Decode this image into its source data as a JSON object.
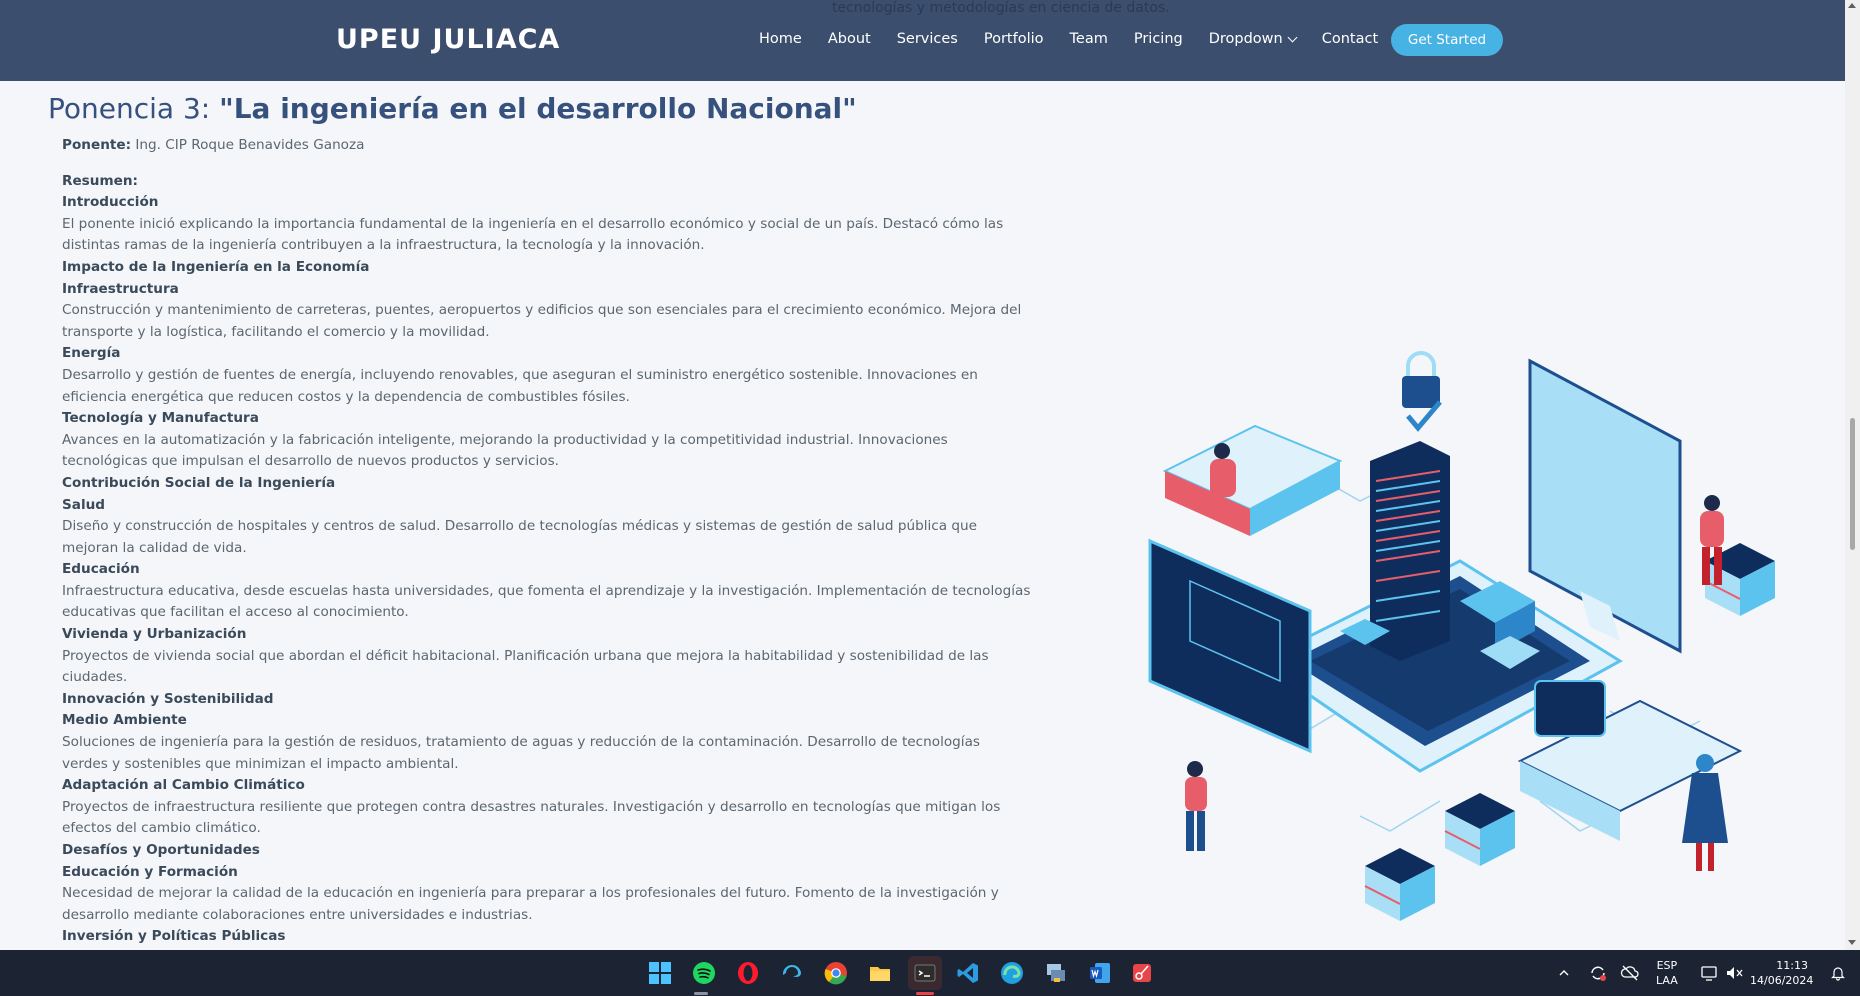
{
  "header": {
    "bleed_text": "tecnologías y metodologías en ciencia de datos.",
    "logo": "UPEU JULIACA",
    "nav": [
      "Home",
      "About",
      "Services",
      "Portfolio",
      "Team",
      "Pricing",
      "Dropdown",
      "Contact"
    ],
    "cta": "Get Started"
  },
  "main": {
    "heading_prefix": "Ponencia 3: ",
    "heading_title": "\"La ingeniería en el desarrollo Nacional\"",
    "speaker_label": "Ponente:",
    "speaker_name": " Ing. CIP Roque Benavides Ganoza",
    "summary_label": "Resumen:",
    "lines": [
      {
        "t": "Introducción",
        "b": true
      },
      {
        "t": "El ponente inició explicando la importancia fundamental de la ingeniería en el desarrollo económico y social de un país. Destacó cómo las",
        "b": false
      },
      {
        "t": "distintas ramas de la ingeniería contribuyen a la infraestructura, la tecnología y la innovación.",
        "b": false
      },
      {
        "t": "Impacto de la Ingeniería en la Economía",
        "b": true
      },
      {
        "t": "Infraestructura",
        "b": true
      },
      {
        "t": "Construcción y mantenimiento de carreteras, puentes, aeropuertos y edificios que son esenciales para el crecimiento económico. Mejora del",
        "b": false
      },
      {
        "t": "transporte y la logística, facilitando el comercio y la movilidad.",
        "b": false
      },
      {
        "t": "Energía",
        "b": true
      },
      {
        "t": "Desarrollo y gestión de fuentes de energía, incluyendo renovables, que aseguran el suministro energético sostenible. Innovaciones en",
        "b": false
      },
      {
        "t": "eficiencia energética que reducen costos y la dependencia de combustibles fósiles.",
        "b": false
      },
      {
        "t": "Tecnología y Manufactura",
        "b": true
      },
      {
        "t": "Avances en la automatización y la fabricación inteligente, mejorando la productividad y la competitividad industrial. Innovaciones",
        "b": false
      },
      {
        "t": "tecnológicas que impulsan el desarrollo de nuevos productos y servicios.",
        "b": false
      },
      {
        "t": "Contribución Social de la Ingeniería",
        "b": true
      },
      {
        "t": "Salud",
        "b": true
      },
      {
        "t": "Diseño y construcción de hospitales y centros de salud. Desarrollo de tecnologías médicas y sistemas de gestión de salud pública que",
        "b": false
      },
      {
        "t": "mejoran la calidad de vida.",
        "b": false
      },
      {
        "t": "Educación",
        "b": true
      },
      {
        "t": "Infraestructura educativa, desde escuelas hasta universidades, que fomenta el aprendizaje y la investigación. Implementación de tecnologías",
        "b": false
      },
      {
        "t": "educativas que facilitan el acceso al conocimiento.",
        "b": false
      },
      {
        "t": "Vivienda y Urbanización",
        "b": true
      },
      {
        "t": "Proyectos de vivienda social que abordan el déficit habitacional. Planificación urbana que mejora la habitabilidad y sostenibilidad de las",
        "b": false
      },
      {
        "t": "ciudades.",
        "b": false
      },
      {
        "t": "Innovación y Sostenibilidad",
        "b": true
      },
      {
        "t": "Medio Ambiente",
        "b": true
      },
      {
        "t": "Soluciones de ingeniería para la gestión de residuos, tratamiento de aguas y reducción de la contaminación. Desarrollo de tecnologías",
        "b": false
      },
      {
        "t": "verdes y sostenibles que minimizan el impacto ambiental.",
        "b": false
      },
      {
        "t": "Adaptación al Cambio Climático",
        "b": true
      },
      {
        "t": "Proyectos de infraestructura resiliente que protegen contra desastres naturales. Investigación y desarrollo en tecnologías que mitigan los",
        "b": false
      },
      {
        "t": "efectos del cambio climático.",
        "b": false
      },
      {
        "t": "Desafíos y Oportunidades",
        "b": true
      },
      {
        "t": "Educación y Formación",
        "b": true
      },
      {
        "t": "Necesidad de mejorar la calidad de la educación en ingeniería para preparar a los profesionales del futuro. Fomento de la investigación y",
        "b": false
      },
      {
        "t": "desarrollo mediante colaboraciones entre universidades e industrias.",
        "b": false
      },
      {
        "t": "Inversión y Políticas Públicas",
        "b": true
      }
    ]
  },
  "taskbar": {
    "lang": "ESP",
    "layout": "LAA",
    "time": "11:13",
    "date": "14/06/2024"
  },
  "colors": {
    "header_bg": "#3b4e6d",
    "accent": "#47b2e4",
    "heading": "#37517e",
    "taskbar_bg": "#1c2434"
  }
}
